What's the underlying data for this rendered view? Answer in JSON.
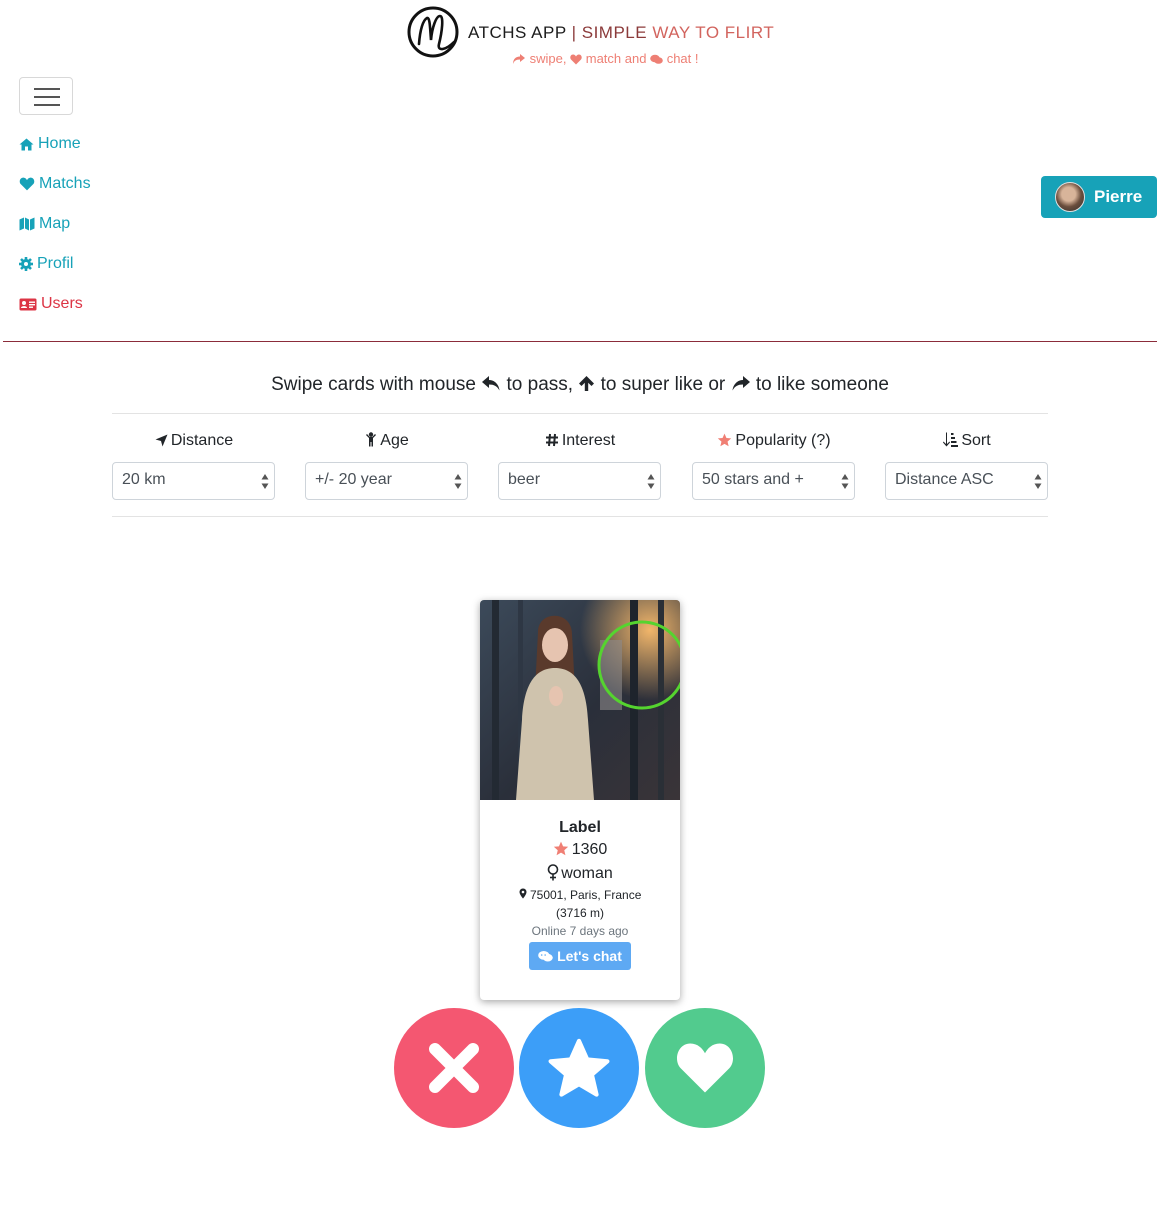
{
  "header": {
    "title_part1": "ATCHS APP",
    "title_sep": " | ",
    "title_part2": "SIMPLE ",
    "title_part3": "WAY TO FLIRT",
    "subtitle_swipe": "swipe,",
    "subtitle_match": "match and",
    "subtitle_chat": "chat !",
    "logo_icon": "m-monogram-logo"
  },
  "nav": {
    "items": [
      {
        "label": "Home",
        "icon": "home-icon"
      },
      {
        "label": "Matchs",
        "icon": "heart-icon"
      },
      {
        "label": "Map",
        "icon": "map-icon"
      },
      {
        "label": "Profil",
        "icon": "gear-icon"
      },
      {
        "label": "Users",
        "icon": "id-card-icon"
      }
    ]
  },
  "user": {
    "name": "Pierre"
  },
  "instructions": {
    "part1": "Swipe cards with mouse",
    "part2": "to pass,",
    "part3": "to super like or",
    "part4": "to like someone"
  },
  "filters": [
    {
      "label": "Distance",
      "value": "20 km",
      "icon": "location-arrow-icon"
    },
    {
      "label": "Age",
      "value": "+/- 20 year",
      "icon": "child-icon"
    },
    {
      "label": "Interest",
      "value": "beer",
      "icon": "hashtag-icon"
    },
    {
      "label": "Popularity (?)",
      "value": "50 stars and +",
      "icon": "star-icon"
    },
    {
      "label": "Sort",
      "value": "Distance ASC",
      "icon": "sort-icon"
    }
  ],
  "card": {
    "name": "Label",
    "popularity": "1360",
    "gender": "woman",
    "location": "75001, Paris, France",
    "distance": "(3716 m)",
    "online": "Online 7 days ago",
    "chat_label": "Let's chat"
  },
  "actions": {
    "pass": "close-icon",
    "super": "star-icon",
    "like": "heart-icon"
  },
  "colors": {
    "accent": "#17a2b8",
    "danger": "#dc3545",
    "subtitle": "#ee7f74",
    "pass": "#f45771",
    "super_like": "#3c9ef8",
    "like": "#52cb8e",
    "chat": "#5ea9f3",
    "divider": "#8b2c3a"
  }
}
